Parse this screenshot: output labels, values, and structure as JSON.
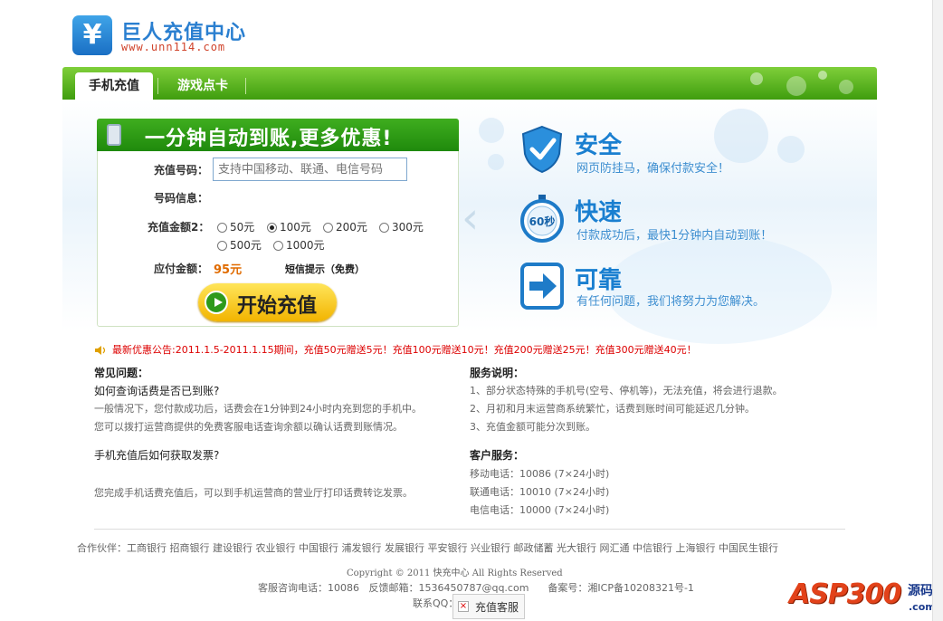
{
  "header": {
    "logo_symbol": "¥",
    "site_title": "巨人充值中心",
    "site_url": "www.unn114.com"
  },
  "nav": {
    "tabs": [
      {
        "label": "手机充值",
        "active": true
      },
      {
        "label": "游戏点卡",
        "active": false
      }
    ]
  },
  "form": {
    "title": "一分钟自动到账,更多优惠!",
    "phone_label": "充值号码：",
    "phone_placeholder": "支持中国移动、联通、电信号码",
    "info_label": "号码信息：",
    "amount_label": "充值金额2：",
    "amount_options": [
      "50元",
      "100元",
      "200元",
      "300元",
      "500元",
      "1000元"
    ],
    "amount_selected": "100元",
    "pay_label": "应付金额：",
    "pay_value": "95元",
    "sms_hint": "短信提示（免费）",
    "start_button": "开始充值"
  },
  "features": [
    {
      "icon": "shield-check-icon",
      "title": "安全",
      "desc": "网页防挂马，确保付款安全！"
    },
    {
      "icon": "stopwatch-icon",
      "icon_text": "60秒",
      "title": "快速",
      "desc": "付款成功后，最快1分钟内自动到账！"
    },
    {
      "icon": "arrow-right-icon",
      "title": "可靠",
      "desc": "有任何问题，我们将努力为您解决。"
    }
  ],
  "notice": "最新优惠公告:2011.1.5-2011.1.15期间，充值50元赠送5元！充值100元赠送10元！充值200元赠送25元！充值300元赠送40元！",
  "faq": {
    "heading": "常见问题：",
    "q1": "如何查询话费是否已到账?",
    "a1_line1": "一般情况下，您付款成功后，话费会在1分钟到24小时内充到您的手机中。",
    "a1_line2": "您可以拨打运营商提供的免费客服电话查询余额以确认话费到账情况。",
    "q2": "手机充值后如何获取发票?",
    "a2": "您完成手机话费充值后，可以到手机运营商的营业厅打印话费转讫发票。"
  },
  "service": {
    "heading": "服务说明：",
    "items": [
      "1、部分状态特殊的手机号(空号、停机等)，无法充值，将会进行退款。",
      "2、月初和月末运营商系统繁忙，话费到账时间可能延迟几分钟。",
      "3、充值金额可能分次到账。"
    ],
    "support_heading": "客户服务：",
    "lines": [
      "移动电话：10086 (7×24小时)",
      "联通电话：10010 (7×24小时)",
      "电信电话：10000 (7×24小时)"
    ]
  },
  "footer": {
    "partners": "合作伙伴：工商银行 招商银行 建设银行 农业银行 中国银行 浦发银行 发展银行 平安银行 兴业银行 邮政储蓄 光大银行 网汇通 中信银行 上海银行 中国民生银行",
    "copyright": "Copyright © 2011 快充中心 All Rights Reserved",
    "contact": "客服咨询电话：10086   反馈邮箱：1536450787@qq.com      备案号：湘ICP备10208321号-1",
    "qq_label": "联系QQ：",
    "qq_button": "充值客服"
  },
  "watermark": {
    "brand": "ASP300",
    "sub": "源码",
    "domain": ".com"
  },
  "colors": {
    "nav_green": "#3f9d0e",
    "title_blue": "#1a7fd0",
    "notice_red": "#dd0000",
    "pay_orange": "#e06b00"
  }
}
